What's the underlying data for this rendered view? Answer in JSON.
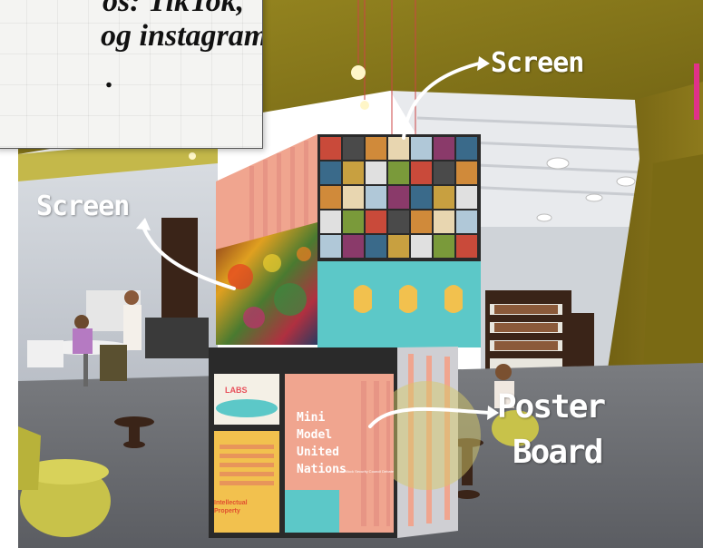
{
  "caption": {
    "line1": "os: TikTok,",
    "line2": "og instagram”",
    "line3": "."
  },
  "labels": {
    "screen_top": "Screen",
    "screen_left": "Screen",
    "poster_line1": "Poster",
    "poster_line2": "Board"
  },
  "poster": {
    "line1": "Mini",
    "line2": "Model",
    "line3": "United",
    "line4": "Nations",
    "small_print": "Join Mock Security Council Debate",
    "labs_logo": "LABS",
    "ip_line1": "Intellectual",
    "ip_line2": "Property"
  },
  "colors": {
    "accent_pink": "#e0318a",
    "ceiling_olive": "#8a7a1e",
    "cube_peach": "#f0a58f",
    "cube_teal": "#5cc8c8",
    "chair_lime": "#c8c24a"
  },
  "icons": [
    "curved-arrow-icon"
  ]
}
